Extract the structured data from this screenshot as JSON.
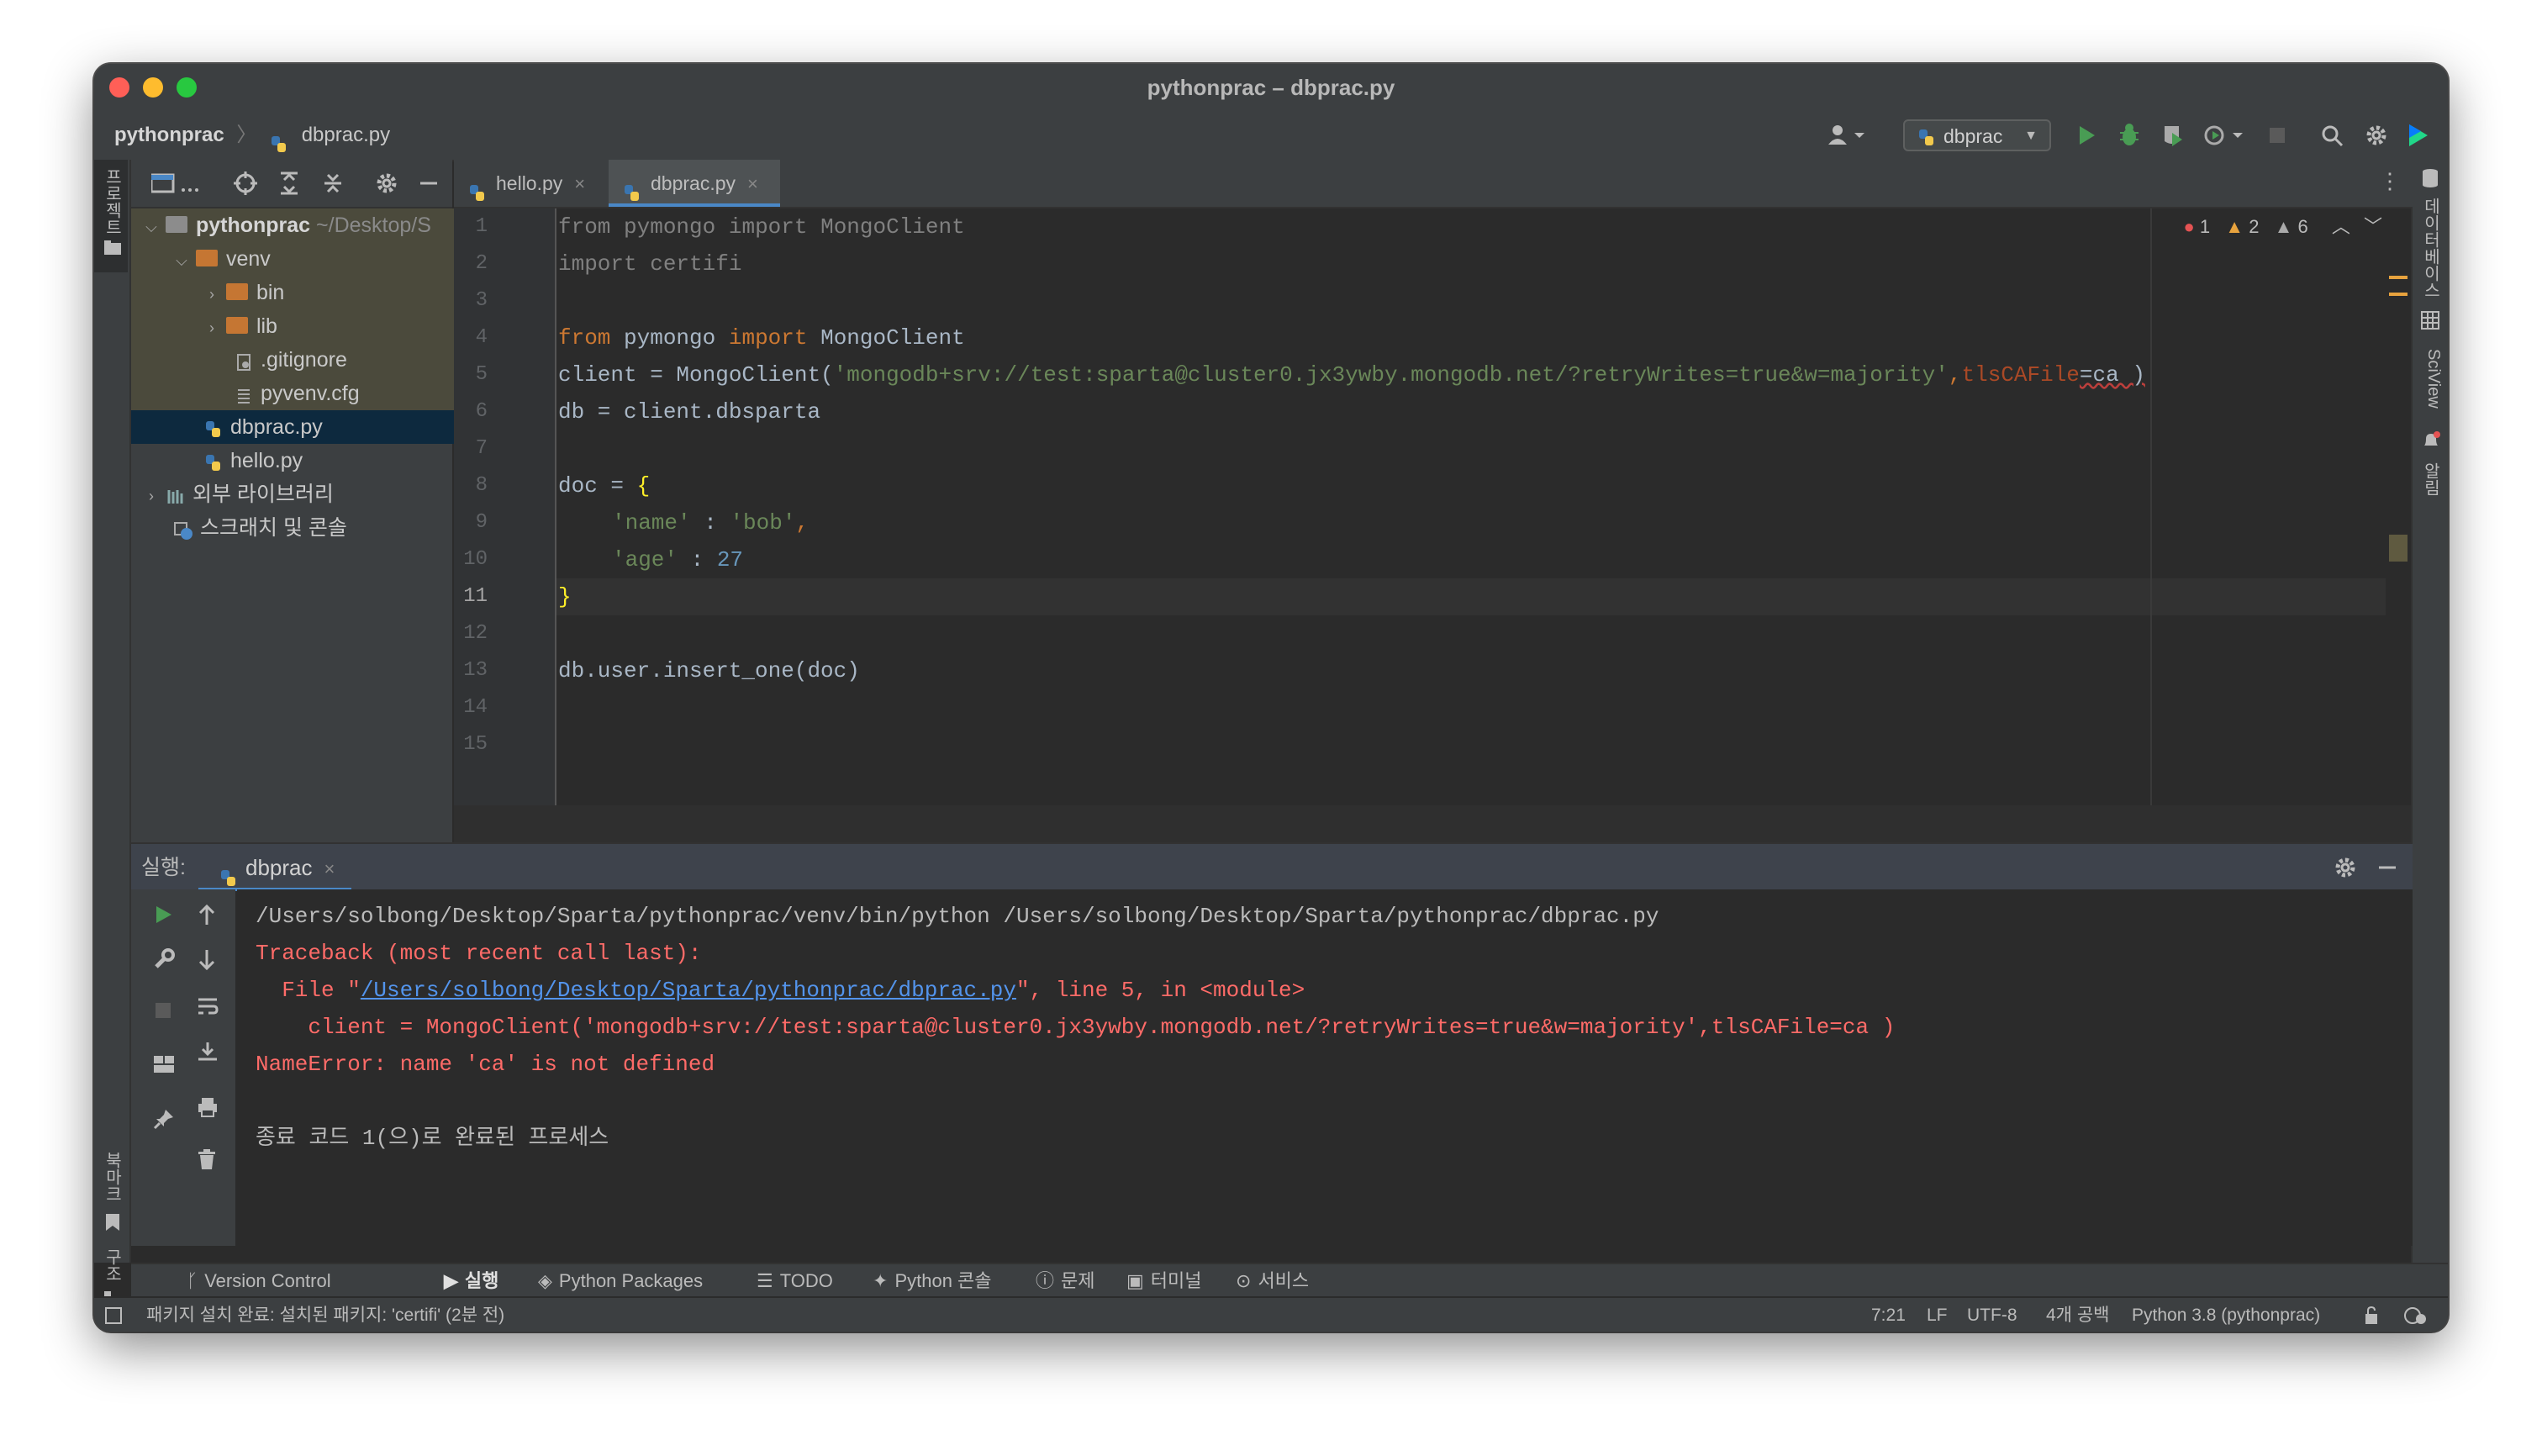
{
  "window": {
    "title": "pythonprac – dbprac.py"
  },
  "breadcrumb": {
    "project": "pythonprac",
    "file": "dbprac.py"
  },
  "toolbar": {
    "run_config": "dbprac"
  },
  "left_strip": {
    "project_tab": "프로젝트",
    "bookmarks_tab": "북마크",
    "structure_tab": "구조"
  },
  "right_strip": {
    "database_tab": "데이터베이스",
    "sciview_tab": "SciView",
    "notifications_tab": "알림"
  },
  "project_tree": {
    "root_name": "pythonprac",
    "root_path": "~/Desktop/S",
    "items": [
      {
        "label": "venv"
      },
      {
        "label": "bin"
      },
      {
        "label": "lib"
      },
      {
        "label": ".gitignore"
      },
      {
        "label": "pyvenv.cfg"
      },
      {
        "label": "dbprac.py"
      },
      {
        "label": "hello.py"
      },
      {
        "label": "외부 라이브러리"
      },
      {
        "label": "스크래치 및 콘솔"
      }
    ]
  },
  "editor_tabs": [
    {
      "label": "hello.py"
    },
    {
      "label": "dbprac.py"
    }
  ],
  "inspections": {
    "errors": "1",
    "warnings": "2",
    "weak_warnings": "6"
  },
  "editor": {
    "line_numbers": [
      "1",
      "2",
      "3",
      "4",
      "5",
      "6",
      "7",
      "8",
      "9",
      "10",
      "11",
      "12",
      "13",
      "14",
      "15"
    ],
    "lines": {
      "l1_from": "from",
      "l1_mod": " pymongo ",
      "l1_import": "import",
      "l1_name": " MongoClient",
      "l2_import": "import",
      "l2_mod": " certifi",
      "l4_from": "from",
      "l4_mod": " pymongo ",
      "l4_import": "import",
      "l4_name": " MongoClient",
      "l5_a": "client = MongoClient(",
      "l5_str": "'mongodb+srv://test:sparta@cluster0.jx3ywby.mongodb.net/?retryWrites=true&w=majority'",
      "l5_comma": ",",
      "l5_param": "tlsCAFile",
      "l5_b": "=ca )",
      "l6": "db = client.dbsparta",
      "l8_a": "doc = ",
      "l8_b": "{",
      "l9_key": "'name'",
      "l9_colon": " : ",
      "l9_val": "'bob'",
      "l9_comma": ",",
      "l10_key": "'age'",
      "l10_colon": " : ",
      "l10_val": "27",
      "l11": "}",
      "l13": "db.user.insert_one(doc)"
    }
  },
  "run_panel": {
    "label": "실행:",
    "tab": "dbprac",
    "output": {
      "cmd": "/Users/solbong/Desktop/Sparta/pythonprac/venv/bin/python /Users/solbong/Desktop/Sparta/pythonprac/dbprac.py",
      "traceback": "Traceback (most recent call last):",
      "file_prefix": "  File \"",
      "file_link": "/Users/solbong/Desktop/Sparta/pythonprac/dbprac.py",
      "file_suffix": "\", line 5, in <module>",
      "code_line": "    client = MongoClient('mongodb+srv://test:sparta@cluster0.jx3ywby.mongodb.net/?retryWrites=true&w=majority',tlsCAFile=ca )",
      "error": "NameError: name 'ca' is not defined",
      "exit": "종료 코드 1(으)로 완료된 프로세스"
    }
  },
  "bottom_tools": [
    {
      "label": "Version Control"
    },
    {
      "label": "실행"
    },
    {
      "label": "Python Packages"
    },
    {
      "label": "TODO"
    },
    {
      "label": "Python 콘솔"
    },
    {
      "label": "문제"
    },
    {
      "label": "터미널"
    },
    {
      "label": "서비스"
    }
  ],
  "status": {
    "message": "패키지 설치 완료: 설치된 패키지: 'certifi' (2분 전)",
    "position": "7:21",
    "line_sep": "LF",
    "encoding": "UTF-8",
    "indent": "4개 공백",
    "interpreter": "Python 3.8 (pythonprac)"
  },
  "colors": {
    "accent": "#4a88c7",
    "error": "#ff6b68",
    "link": "#5394ec",
    "run_green": "#499c54",
    "folder": "#c57633"
  }
}
